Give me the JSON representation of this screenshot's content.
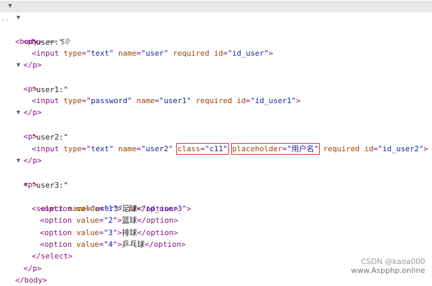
{
  "body": {
    "open": "<body>",
    "marker": "== $0",
    "dots": "..",
    "close": "</body>"
  },
  "p_open": "<p>",
  "p_close": "</p>",
  "p1": {
    "text": "\"user:\"",
    "input": {
      "type": "text",
      "name": "user",
      "id": "id_user"
    }
  },
  "p2": {
    "text": "\"user1:\"",
    "input": {
      "type": "password",
      "name": "user1",
      "id": "id_user1"
    }
  },
  "p3": {
    "text": "\"user2:\"",
    "input": {
      "type": "text",
      "name": "user2",
      "class": "c11",
      "placeholder": "用户名",
      "id": "id_user2"
    }
  },
  "p4": {
    "text": "\"user3:\"",
    "select": {
      "name": "user3",
      "id": "id_user3"
    },
    "options": [
      {
        "value": "1",
        "label": "足球"
      },
      {
        "value": "2",
        "label": "篮球"
      },
      {
        "value": "3",
        "label": "排球"
      },
      {
        "value": "4",
        "label": "乒乓球"
      }
    ],
    "select_close": "</select>"
  },
  "syntax": {
    "lt": "<",
    "gt": ">",
    "input_tag": "input",
    "select_tag": "select",
    "option_tag": "option",
    "option_close": "</option>",
    "required": "required",
    "type": "type",
    "name": "name",
    "id": "id",
    "class": "class",
    "placeholder": "placeholder",
    "value": "value",
    "eq": "=",
    "q": "\""
  },
  "watermark": {
    "csdn": "CSDN @kaoa000",
    "site": "www.Aspphp.online"
  }
}
